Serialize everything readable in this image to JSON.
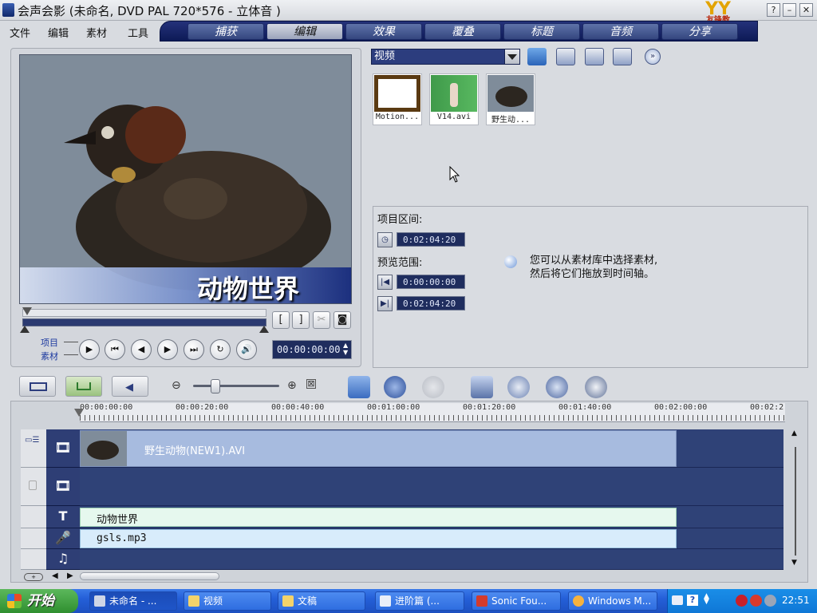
{
  "window": {
    "title": "会声会影 (未命名, DVD PAL 720*576 - 立体音  )",
    "brand_logo": "YY",
    "brand_logo_sub": "友锋教",
    "help_label": "?",
    "minimize_label": "–",
    "close_label": "✕"
  },
  "menu": {
    "items": [
      "文件",
      "编辑",
      "素材",
      "工具"
    ]
  },
  "steps": {
    "tabs": [
      "捕获",
      "编辑",
      "效果",
      "覆叠",
      "标题",
      "音频",
      "分享"
    ],
    "active": "编辑"
  },
  "preview": {
    "caption": "动物世界",
    "mode_labels": [
      "项目",
      "素材"
    ],
    "timecode": "00:00:00:00",
    "mark_in": "[",
    "mark_out": "]"
  },
  "library": {
    "dropdown_value": "视频",
    "thumbnails": [
      {
        "caption": "Motion..."
      },
      {
        "caption": "V14.avi"
      },
      {
        "caption": "野生动..."
      }
    ]
  },
  "info": {
    "project_duration_label": "项目区间:",
    "project_duration": "0:02:04:20",
    "preview_range_label": "预览范围:",
    "preview_start": "0:00:00:00",
    "preview_end": "0:02:04:20",
    "hint_line1": "您可以从素材库中选择素材,",
    "hint_line2": "然后将它们拖放到时间轴。"
  },
  "timeline": {
    "ruler": [
      "00:00:00:00",
      "00:00:20:00",
      "00:00:40:00",
      "00:01:00:00",
      "00:01:20:00",
      "00:01:40:00",
      "00:02:00:00",
      "00:02:2"
    ],
    "video_clip": "野生动物(NEW1).AVI",
    "title_clip": "动物世界",
    "voice_clip": "gsls.mp3"
  },
  "taskbar": {
    "start_label": "开始",
    "tasks": [
      "未命名 - ...",
      "视频",
      "文稿",
      "进阶篇 (...",
      "Sonic Fou...",
      "Windows M..."
    ],
    "clock": "22:51"
  },
  "colors": {
    "accent": "#2c3d7e",
    "taskbar": "#245fd8"
  }
}
